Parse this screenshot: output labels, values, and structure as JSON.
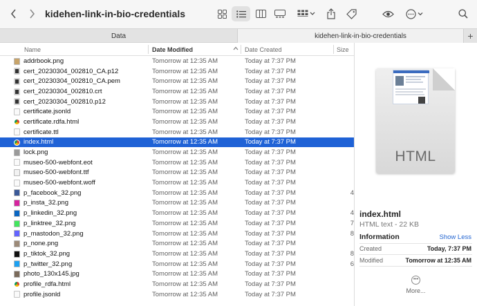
{
  "window": {
    "title": "kidehen-link-in-bio-credentials"
  },
  "toolbar": {
    "back_glyph": "‹",
    "forward_glyph": "›",
    "icons": [
      "grid-view-icon",
      "list-view-icon",
      "column-view-icon",
      "gallery-view-icon",
      "group-icon",
      "share-icon",
      "tag-icon",
      "eye-icon",
      "more-icon",
      "search-icon"
    ]
  },
  "tabs": [
    {
      "label": "Data"
    },
    {
      "label": "kidehen-link-in-bio-credentials"
    }
  ],
  "tab_add": "+",
  "columns": {
    "name": "Name",
    "modified": "Date Modified",
    "created": "Date Created",
    "size": "Size"
  },
  "rows": [
    {
      "name": "addrbook.png",
      "modified": "Tomorrow at 12:35 AM",
      "created": "Today at 7:37 PM",
      "size": "",
      "icon": "image",
      "color": "#c8a46a"
    },
    {
      "name": "cert_20230304_002810_CA.p12",
      "modified": "Tomorrow at 12:35 AM",
      "created": "Today at 7:37 PM",
      "size": "",
      "icon": "cert",
      "color": "#333333"
    },
    {
      "name": "cert_20230304_002810_CA.pem",
      "modified": "Tomorrow at 12:35 AM",
      "created": "Today at 7:37 PM",
      "size": "",
      "icon": "cert",
      "color": "#333333"
    },
    {
      "name": "cert_20230304_002810.crt",
      "modified": "Tomorrow at 12:35 AM",
      "created": "Today at 7:37 PM",
      "size": "",
      "icon": "cert",
      "color": "#333333"
    },
    {
      "name": "cert_20230304_002810.p12",
      "modified": "Tomorrow at 12:35 AM",
      "created": "Today at 7:37 PM",
      "size": "",
      "icon": "cert",
      "color": "#333333"
    },
    {
      "name": "certificate.jsonld",
      "modified": "Tomorrow at 12:35 AM",
      "created": "Today at 7:37 PM",
      "size": "",
      "icon": "doc",
      "color": "#e8e8e8"
    },
    {
      "name": "certificate.rdfa.html",
      "modified": "Tomorrow at 12:35 AM",
      "created": "Today at 7:37 PM",
      "size": "",
      "icon": "chrome",
      "color": "#db4437"
    },
    {
      "name": "certificate.ttl",
      "modified": "Tomorrow at 12:35 AM",
      "created": "Today at 7:37 PM",
      "size": "",
      "icon": "doc",
      "color": "#e8e8e8"
    },
    {
      "name": "index.html",
      "modified": "Tomorrow at 12:35 AM",
      "created": "Today at 7:37 PM",
      "size": "",
      "icon": "chrome",
      "color": "#db4437",
      "selected": true
    },
    {
      "name": "lock.png",
      "modified": "Tomorrow at 12:35 AM",
      "created": "Today at 7:37 PM",
      "size": "",
      "icon": "image",
      "color": "#9a9a9a"
    },
    {
      "name": "museo-500-webfont.eot",
      "modified": "Tomorrow at 12:35 AM",
      "created": "Today at 7:37 PM",
      "size": "",
      "icon": "doc",
      "color": "#e8e8e8"
    },
    {
      "name": "museo-500-webfont.ttf",
      "modified": "Tomorrow at 12:35 AM",
      "created": "Today at 7:37 PM",
      "size": "",
      "icon": "font",
      "color": "#cfcfcf"
    },
    {
      "name": "museo-500-webfont.woff",
      "modified": "Tomorrow at 12:35 AM",
      "created": "Today at 7:37 PM",
      "size": "",
      "icon": "doc",
      "color": "#e8e8e8"
    },
    {
      "name": "p_facebook_32.png",
      "modified": "Tomorrow at 12:35 AM",
      "created": "Today at 7:37 PM",
      "size": "4",
      "icon": "image",
      "color": "#3b5998"
    },
    {
      "name": "p_insta_32.png",
      "modified": "Tomorrow at 12:35 AM",
      "created": "Today at 7:37 PM",
      "size": "",
      "icon": "image",
      "color": "#d6249f"
    },
    {
      "name": "p_linkedin_32.png",
      "modified": "Tomorrow at 12:35 AM",
      "created": "Today at 7:37 PM",
      "size": "4",
      "icon": "image",
      "color": "#0a66c2"
    },
    {
      "name": "p_linktree_32.png",
      "modified": "Tomorrow at 12:35 AM",
      "created": "Today at 7:37 PM",
      "size": "7",
      "icon": "image",
      "color": "#43e55e"
    },
    {
      "name": "p_mastodon_32.png",
      "modified": "Tomorrow at 12:35 AM",
      "created": "Today at 7:37 PM",
      "size": "8",
      "icon": "image",
      "color": "#6364ff"
    },
    {
      "name": "p_none.png",
      "modified": "Tomorrow at 12:35 AM",
      "created": "Today at 7:37 PM",
      "size": "",
      "icon": "image",
      "color": "#9c8a78"
    },
    {
      "name": "p_tiktok_32.png",
      "modified": "Tomorrow at 12:35 AM",
      "created": "Today at 7:37 PM",
      "size": "8",
      "icon": "image",
      "color": "#111111"
    },
    {
      "name": "p_twitter_32.png",
      "modified": "Tomorrow at 12:35 AM",
      "created": "Today at 7:37 PM",
      "size": "6",
      "icon": "image",
      "color": "#1da1f2"
    },
    {
      "name": "photo_130x145.jpg",
      "modified": "Tomorrow at 12:35 AM",
      "created": "Today at 7:37 PM",
      "size": "",
      "icon": "image",
      "color": "#7a6a5a"
    },
    {
      "name": "profile_rdfa.html",
      "modified": "Tomorrow at 12:35 AM",
      "created": "Today at 7:37 PM",
      "size": "",
      "icon": "chrome",
      "color": "#db4437"
    },
    {
      "name": "profile.jsonld",
      "modified": "Tomorrow at 12:35 AM",
      "created": "Today at 7:37 PM",
      "size": "",
      "icon": "doc",
      "color": "#e8e8e8"
    }
  ],
  "preview": {
    "doc_label": "HTML",
    "name": "index.html",
    "kind": "HTML text - 22 KB",
    "info_heading": "Information",
    "show_less": "Show Less",
    "created_label": "Created",
    "created_value": "Today, 7:37 PM",
    "modified_label": "Modified",
    "modified_value": "Tomorrow at 12:35 AM",
    "more_label": "More..."
  },
  "colors": {
    "selection": "#1f62d6",
    "link": "#2365d1"
  }
}
